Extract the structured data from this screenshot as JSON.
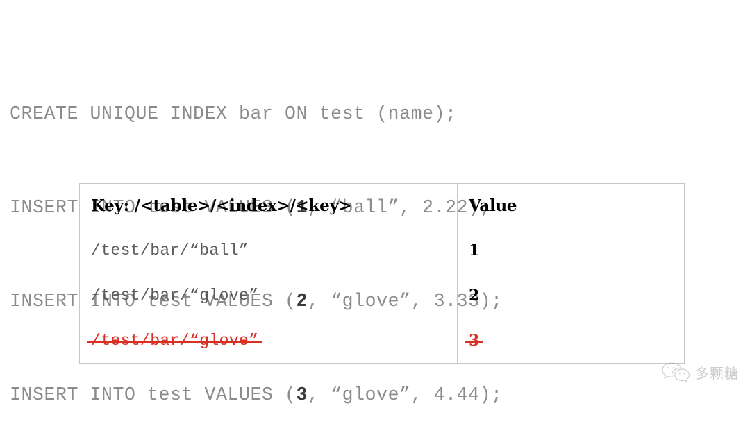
{
  "code_block": {
    "language": "sql",
    "text_color": "#8b8b8b",
    "highlight_color": "#3a3a3a",
    "lines": [
      {
        "before": "CREATE UNIQUE INDEX bar ON test (name);",
        "num": "",
        "after": ""
      },
      {
        "before": "INSERT INTO test VALUES (",
        "num": "1",
        "after": ", “ball”, 2.22);"
      },
      {
        "before": "INSERT INTO test VALUES (",
        "num": "2",
        "after": ", “glove”, 3.33);"
      },
      {
        "before": "INSERT INTO test VALUES (",
        "num": "3",
        "after": ", “glove”, 4.44);"
      }
    ]
  },
  "table": {
    "headers": {
      "key": "Key: /<table>/<index>/<key>",
      "value": "Value"
    },
    "rows": [
      {
        "key": "/test/bar/“ball”",
        "value": "1",
        "deleted": false
      },
      {
        "key": "/test/bar/“glove”",
        "value": "2",
        "deleted": false
      },
      {
        "key": "/test/bar/“glove”",
        "value": "3",
        "deleted": true
      }
    ],
    "border_color": "#c7c7c7",
    "deleted_color": "#d93025"
  },
  "watermark": {
    "text": "多颗糖",
    "icon": "wechat-logo-icon",
    "color": "#9a9a9a"
  }
}
